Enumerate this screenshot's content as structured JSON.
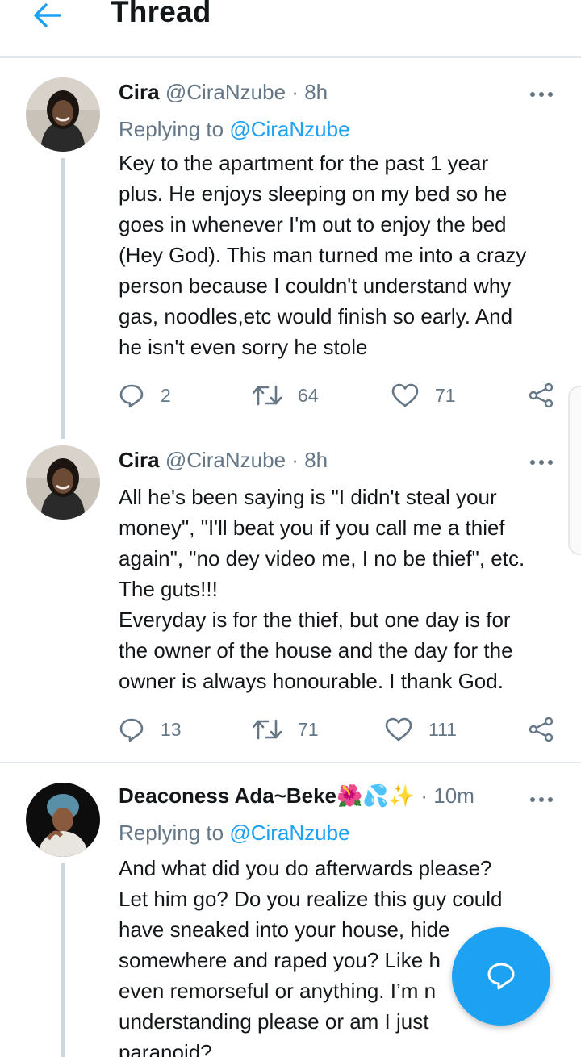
{
  "header": {
    "title": "Thread",
    "back_icon": "arrow-left-icon"
  },
  "tweets": [
    {
      "name": "Cira",
      "handle": "@CiraNzube",
      "separator": "·",
      "time": "8h",
      "replying_label": "Replying to",
      "replying_to": "@CiraNzube",
      "text": "Key to the apartment for the past 1 year\nplus. He enjoys sleeping on my bed so he\ngoes in whenever I'm out to enjoy the bed\n(Hey God). This man turned me into a crazy\nperson because I couldn't understand why\ngas, noodles,etc would finish so early. And\nhe isn't even sorry he stole",
      "replies": "2",
      "retweets": "64",
      "likes": "71"
    },
    {
      "name": "Cira",
      "handle": "@CiraNzube",
      "separator": "·",
      "time": "8h",
      "text": "All he's been saying is \"I didn't steal your\nmoney\", \"I'll beat you if you call me a thief\nagain\", \"no dey video me, I no be thief\", etc.\nThe guts!!!\nEveryday is for the thief, but one day is for\nthe owner of the house and the day for the\nowner is always honourable. I thank God.",
      "replies": "13",
      "retweets": "71",
      "likes": "111"
    },
    {
      "name": "Deaconess Ada~Beke",
      "emojis": "🌺💦✨",
      "separator": "·",
      "time": "10m",
      "replying_label": "Replying to",
      "replying_to": "@CiraNzube",
      "text": "And what did you do afterwards please?\nLet him go? Do you realize this guy could\nhave sneaked into your house, hide\nsomewhere and raped you? Like h\neven remorseful or anything. I’m n\nunderstanding please or am I just\nparanoid?"
    }
  ],
  "fab": {
    "icon": "compose-reply-icon"
  },
  "colors": {
    "accent": "#1da1f2",
    "muted": "#657786",
    "text": "#14171a",
    "divider": "#e1e8ed"
  }
}
